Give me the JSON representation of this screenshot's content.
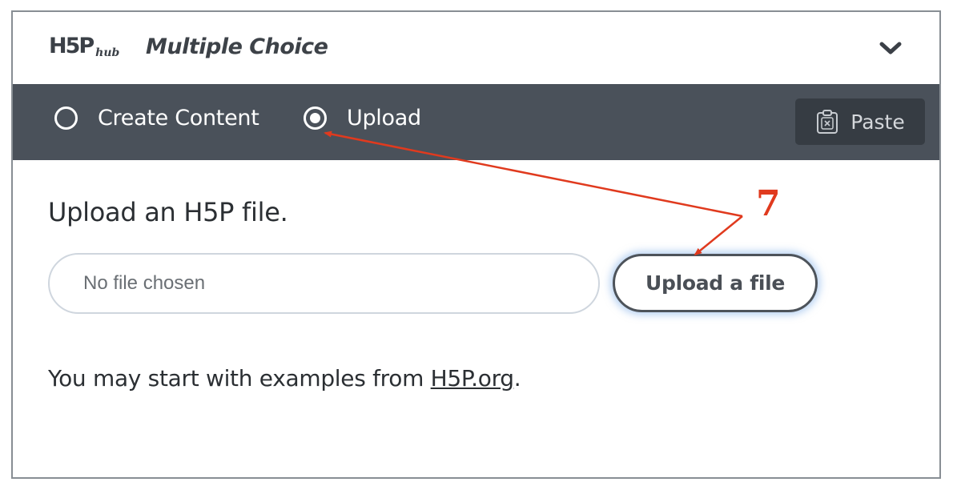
{
  "header": {
    "logo_main": "H5P",
    "logo_sub": "hub",
    "content_type": "Multiple Choice",
    "collapse_icon": "chevron-down-icon"
  },
  "tabs": [
    {
      "label": "Create Content",
      "selected": false
    },
    {
      "label": "Upload",
      "selected": true
    }
  ],
  "paste": {
    "label": "Paste",
    "icon": "clipboard-icon"
  },
  "upload": {
    "title": "Upload an H5P file.",
    "file_status": "No file chosen",
    "button_label": "Upload a file"
  },
  "examples": {
    "prefix": "You may start with examples from ",
    "link_text": "H5P.org",
    "suffix": "."
  },
  "annotation": {
    "step_number": "7",
    "color": "#e03a1e"
  },
  "colors": {
    "tab_bar": "#4a515a",
    "paste_button": "#363c43",
    "upload_focus_glow": "#78aae6"
  }
}
